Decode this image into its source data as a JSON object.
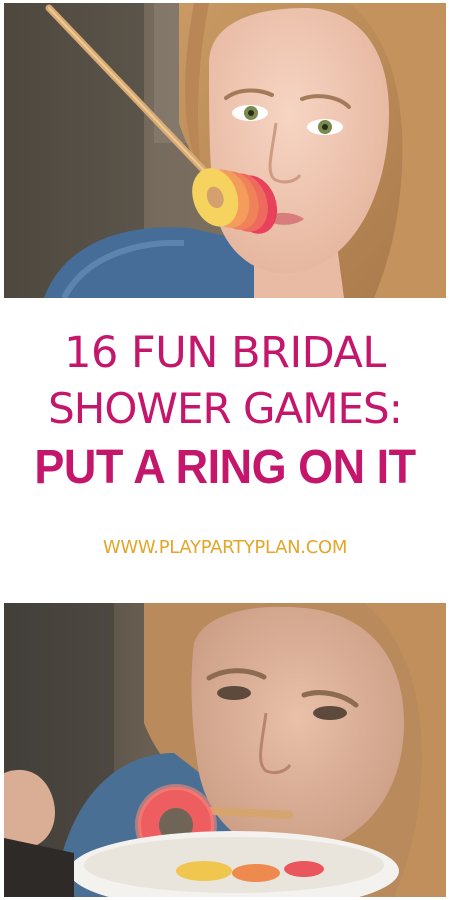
{
  "headline": {
    "line1": "16 FUN BRIDAL",
    "line2": "SHOWER GAMES:",
    "line3": "PUT A RING ON IT"
  },
  "website": "WWW.PLAYPARTYPLAN.COM",
  "colors": {
    "headline": "#c4166b",
    "website": "#e3a62a",
    "background": "#ffffff"
  }
}
